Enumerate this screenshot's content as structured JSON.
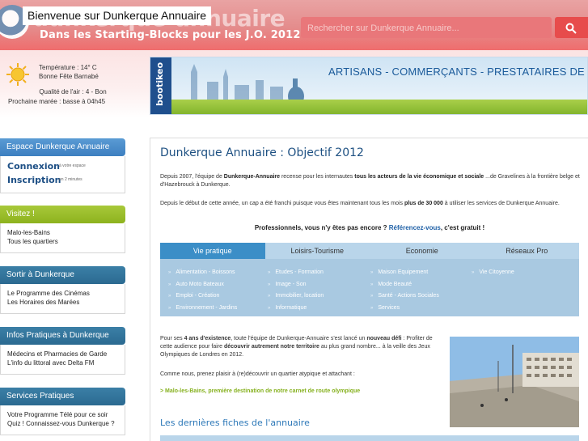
{
  "header": {
    "site_title": "Bienvenue sur Dunkerque Annuaire",
    "logo_text": "dunkerque-annuaire",
    "tagline": "Dans les Starting-Blocks pour les J.O. 2012",
    "search_placeholder": "Rechercher sur Dunkerque Annuaire..."
  },
  "weather": {
    "temperature": "Température : 14° C",
    "saint": "Bonne Fête Barnabé",
    "air_quality": "Qualité de l'air : 4 - Bon",
    "tide": "Prochaine marée : basse à 04h45"
  },
  "banner": {
    "brand": "bootikeo",
    "text": "ARTISANS - COMMERÇANTS - PRESTATAIRES DE SERVICES - PRODUCTEURS"
  },
  "sidebar": {
    "espace": {
      "title": "Espace Dunkerque Annuaire",
      "connexion": "Connexion",
      "connexion_note": "à votre espace",
      "inscription": "Inscription",
      "inscription_note": "en 2 minutes"
    },
    "visitez": {
      "title": "Visitez !",
      "links": [
        "Malo-les-Bains",
        "Tous les quartiers"
      ]
    },
    "sortir": {
      "title": "Sortir à Dunkerque",
      "links": [
        "Le Programme des Cinémas",
        "Les Horaires des Marées"
      ]
    },
    "infos": {
      "title": "Infos Pratiques à Dunkerque",
      "links": [
        "Médecins et Pharmacies de Garde",
        "L'info du littoral avec Delta FM"
      ]
    },
    "services": {
      "title": "Services Pratiques",
      "links": [
        "Votre Programme Télé pour ce soir",
        "Quiz ! Connaissez-vous Dunkerque ?"
      ]
    }
  },
  "main": {
    "title": "Dunkerque Annuaire : Objectif 2012",
    "p1_a": "Depuis 2007, l'équipe de ",
    "p1_b": "Dunkerque-Annuaire",
    "p1_c": " recense pour les internautes ",
    "p1_d": "tous les acteurs de la vie économique et sociale",
    "p1_e": " ...de Gravelines à la frontière belge et d'Hazebrouck à Dunkerque.",
    "p2_a": "Depuis le début de cette année,  un cap a été franchi puisque vous êtes maintenant tous les mois ",
    "p2_b": "plus de 30 000",
    "p2_c": " à utiliser les services de Dunkerque Annuaire.",
    "cta_a": "Professionnels, vous n'y êtes pas encore ? ",
    "cta_link": "Référencez-vous",
    "cta_b": ", c'est gratuit !",
    "tabs": [
      "Vie pratique",
      "Loisirs-Tourisme",
      "Economie",
      "Réseaux Pro"
    ],
    "categories": [
      [
        "Alimentation - Boissons",
        "Auto Moto Bateaux",
        "Emploi - Création",
        "Environnement - Jardins"
      ],
      [
        "Etudes - Formation",
        "Image - Son",
        "Immobilier, location",
        "Informatique"
      ],
      [
        "Maison Equipement",
        "Mode Beauté",
        "Santé - Actions Sociales",
        "Services"
      ],
      [
        "Vie Citoyenne"
      ]
    ],
    "p3_a": "Pour ses ",
    "p3_b": "4 ans d'existence",
    "p3_c": ", toute l'équipe de Dunkerque-Annuaire s'est lancé un ",
    "p3_d": "nouveau défi",
    "p3_e": " : Profiter de cette audience pour faire ",
    "p3_f": "découvrir autrement notre territoire",
    "p3_g": " au plus grand nombre... à la veille des Jeux Olympiques de Londres en 2012.",
    "p4": "Comme nous, prenez plaisir à (re)découvrir un quartier atypique et attachant :",
    "malo": "> Malo-les-Bains, première destination de notre carnet de route olympique",
    "section2": "Les dernières fiches de l'annuaire"
  }
}
